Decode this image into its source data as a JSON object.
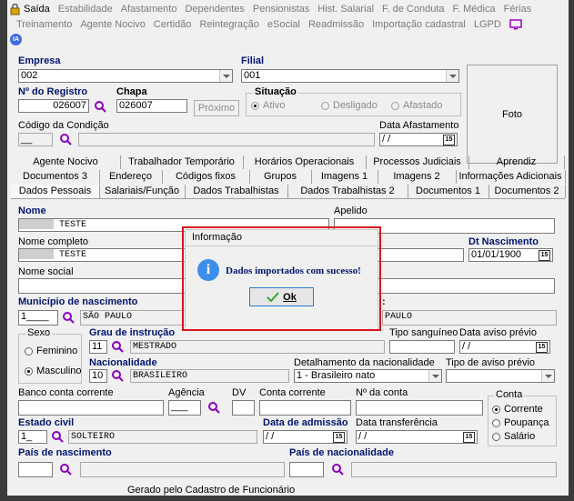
{
  "menu": {
    "row1": [
      "Saída",
      "Estabilidade",
      "Afastamento",
      "Dependentes",
      "Pensionistas",
      "Hist. Salarial",
      "F. de Conduta",
      "F. Médica",
      "Férias"
    ],
    "row2": [
      "Treinamento",
      "Agente Nocivo",
      "Certidão",
      "Reintegração",
      "eSocial",
      "Readmissão",
      "Importação cadastral",
      "LGPD"
    ],
    "ia_badge": "IA"
  },
  "empresa": {
    "label": "Empresa",
    "value": "002"
  },
  "filial": {
    "label": "Filial",
    "value": "001"
  },
  "foto_label": "Foto",
  "registro": {
    "label": "Nº do Registro",
    "value": "026007"
  },
  "chapa": {
    "label": "Chapa",
    "value": "026007"
  },
  "proximo_label": "Próximo",
  "situacao": {
    "label": "Situação",
    "options": [
      "Ativo",
      "Desligado",
      "Afastado"
    ],
    "selected": "Ativo"
  },
  "codigo_condicao": {
    "label": "Código da Condição",
    "value": "__"
  },
  "data_afastamento": {
    "label": "Data Afastamento",
    "value": "/ /"
  },
  "tabs_row1": [
    "Agente Nocivo",
    "Trabalhador Temporário",
    "Horários Operacionais",
    "Processos Judiciais",
    "Aprendiz"
  ],
  "tabs_row2": [
    "Documentos 3",
    "Endereço",
    "Códigos fixos",
    "Grupos",
    "Imagens 1",
    "Imagens 2",
    "Informações Adicionais"
  ],
  "tabs_row3": [
    "Dados Pessoais",
    "Salariais/Função",
    "Dados Trabalhistas",
    "Dados Trabalhistas 2",
    "Documentos 1",
    "Documentos 2"
  ],
  "nome": {
    "label": "Nome",
    "value": "TESTE"
  },
  "apelido": {
    "label": "Apelido",
    "value": ""
  },
  "nome_completo": {
    "label": "Nome completo",
    "value": "TESTE"
  },
  "dt_nascimento": {
    "label": "Dt Nascimento",
    "value": "01/01/1900"
  },
  "nome_social": {
    "label": "Nome social",
    "value": ""
  },
  "municipio": {
    "label": "Município de nascimento",
    "code": "1____",
    "value": "SÃO PAULO",
    "right_value": "PAULO"
  },
  "sexo": {
    "label": "Sexo",
    "options": [
      "Feminino",
      "Masculino"
    ],
    "selected": "Masculino"
  },
  "grau_instrucao": {
    "label": "Grau de instrução",
    "code": "11",
    "value": "MESTRADO"
  },
  "tipo_sanguineo": {
    "label": "Tipo sanguíneo",
    "value": ""
  },
  "data_aviso_previo": {
    "label": "Data aviso prévio",
    "value": "/ /"
  },
  "nacionalidade": {
    "label": "Nacionalidade",
    "code": "10",
    "value": "BRASILEIRO"
  },
  "detalhamento": {
    "label": "Detalhamento da nacionalidade",
    "value": "1 - Brasileiro nato"
  },
  "tipo_aviso_previo": {
    "label": "Tipo de aviso prévio",
    "value": ""
  },
  "banco": {
    "label": "Banco conta corrente",
    "value": ""
  },
  "agencia": {
    "label": "Agência",
    "value": "___"
  },
  "dv": {
    "label": "DV",
    "value": ""
  },
  "conta_corrente": {
    "label": "Conta corrente",
    "value": ""
  },
  "num_conta": {
    "label": "Nº da conta",
    "value": ""
  },
  "conta": {
    "label": "Conta",
    "options": [
      "Corrente",
      "Poupança",
      "Salário"
    ],
    "selected": "Corrente"
  },
  "estado_civil": {
    "label": "Estado civil",
    "code": "1_",
    "value": "SOLTEIRO"
  },
  "data_admissao": {
    "label": "Data de admissão",
    "value": "/ /"
  },
  "data_transferencia": {
    "label": "Data transferência",
    "value": "/ /"
  },
  "pais_nascimento": {
    "label": "País de nascimento",
    "value": ""
  },
  "pais_nacionalidade": {
    "label": "País de nacionalidade",
    "value": ""
  },
  "footer": "Gerado pelo Cadastro de Funcionário",
  "dialog": {
    "title": "Informação",
    "message": "Dados importados com sucesso!",
    "ok_label": "Ok",
    "icon_glyph": "i"
  },
  "colors": {
    "label_blue": "#00146e",
    "dialog_border": "#d8141e",
    "info_icon": "#3d8eea",
    "ok_check": "#2ea832"
  }
}
